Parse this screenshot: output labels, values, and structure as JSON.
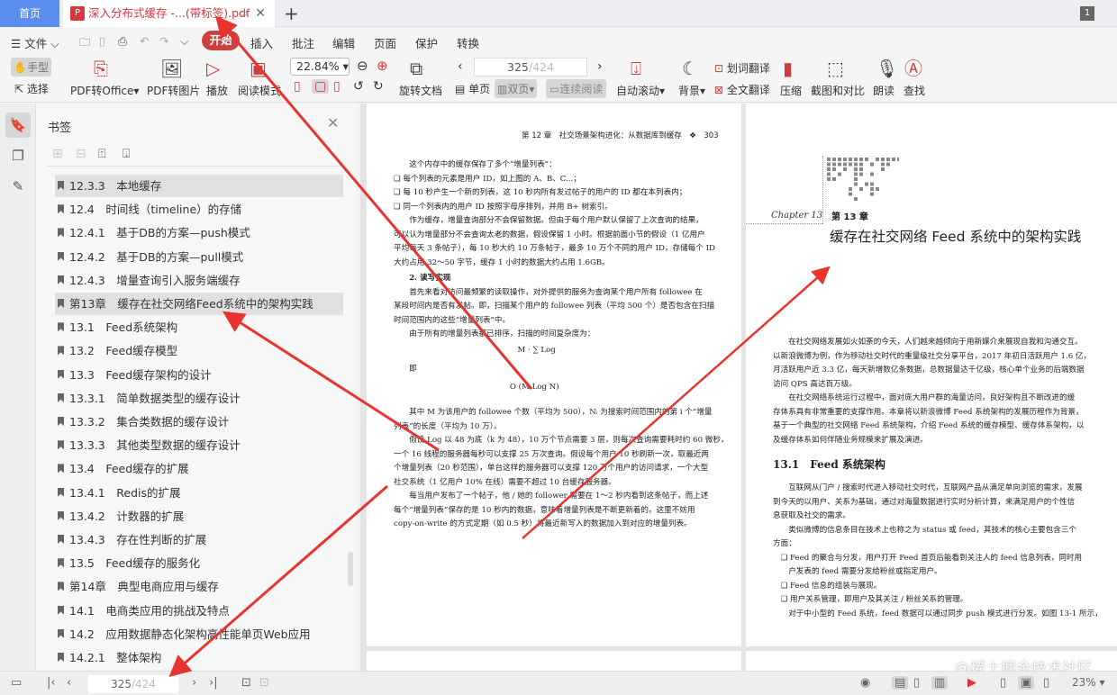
{
  "tabs": {
    "home": "首页",
    "doc": "深入分布式缓存 -...(带标签).pdf",
    "new": "+",
    "count": "1"
  },
  "menu": {
    "file": "文件",
    "items": [
      "开始",
      "插入",
      "批注",
      "编辑",
      "页面",
      "保护",
      "转换"
    ]
  },
  "toolbar": {
    "hand": "手型",
    "select": "选择",
    "pdf_office": "PDF转Office",
    "pdf_image": "PDF转图片",
    "play": "播放",
    "read_mode": "阅读模式",
    "zoom": "22.84%",
    "rotate": "旋转文档",
    "single": "单页",
    "double": "双页",
    "continuous": "连续阅读",
    "auto_scroll": "自动滚动",
    "background": "背景",
    "word_translate": "划词翻译",
    "full_translate": "全文翻译",
    "compress": "压缩",
    "screenshot": "截图和对比",
    "read_aloud": "朗读",
    "find": "查找",
    "page_current": "325",
    "page_total": "/424"
  },
  "panel": {
    "title": "书签",
    "bookmarks": [
      "12.3.3　本地缓存",
      "12.4　时间线（timeline）的存储",
      "12.4.1　基于DB的方案—push模式",
      "12.4.2　基于DB的方案—pull模式",
      "12.4.3　增量查询引入服务端缓存",
      "第13章　缓存在社交网络Feed系统中的架构实践",
      "13.1　Feed系统架构",
      "13.2　Feed缓存模型",
      "13.3　Feed缓存架构的设计",
      "13.3.1　简单数据类型的缓存设计",
      "13.3.2　集合类数据的缓存设计",
      "13.3.3　其他类型数据的缓存设计",
      "13.4　Feed缓存的扩展",
      "13.4.1　Redis的扩展",
      "13.4.2　计数器的扩展",
      "13.4.3　存在性判断的扩展",
      "13.5　Feed缓存的服务化",
      "第14章　典型电商应用与缓存",
      "14.1　电商类应用的挑战及特点",
      "14.2　应用数据静态化架构高性能单页Web应用",
      "14.2.1　整体架构"
    ]
  },
  "left_page": {
    "header": "第 12 章　社交场景架构进化：从数据库到缓存　❖　303",
    "lines": [
      "　　这个内存中的缓存保存了多个“增量列表”：",
      "❑ 每个列表的元素是用户 ID，如上图的 A、B、C...；",
      "❑ 每 10 秒产生一个新的列表，这 10 秒内所有发过帖子的用户的 ID 都在本列表内；",
      "❑ 同一个列表内的用户 ID 按照字母序排列，并用 B+ 树索引。",
      "　　作为缓存，增量查询部分不会保留数据。但由于每个用户默认保留了上次查询的结果，",
      "可以认为增量部分不会查询太老的数据，假设保留 1 小时。根据前面小节的假设（1 亿用户",
      "平均每天 3 条帖子），每 10 秒大约 10 万条帖子，最多 10 万个不同的用户 ID，存储每个 ID",
      "大约占用 32～50 字节，缓存 1 小时的数据大约占用 1.6GB。",
      "　　2. 读写实现",
      "　　首先来看对访问最频繁的读取操作，对外提供的服务为查询某个用户所有 followee 在",
      "某段时间内是否有发帖。即，扫描某个用户的 followee 列表（平均 500 个）是否包含在扫描",
      "时间范围内的这些“增量列表”中。",
      "　　由于所有的增量列表都已排序，扫描的时间复杂度为：",
      "　　　　　　　　　　　　　　　　M · ∑ Log",
      "　　即",
      "　　　　　　　　　　　　　　　O (M Log N)",
      "　　其中 M 为该用户的 followee 个数（平均为 500），Nᵢ 为搜索时间范围内的第 i 个“增量",
      "列表”的长度（平均为 10 万）。",
      "　　假设 Log 以 48 为底（k 为 48），10 万个节点需要 3 层，则每次查询需要耗时约 60 微秒，",
      "一个 16 线程的服务器每秒可以支撑 25 万次查询。假设每个用户 10 秒刷新一次，取最近两",
      "个增量列表（20 秒范围），单台这样的服务器可以支撑 120 万个用户的访问请求，一个大型",
      "社交系统（1 亿用户 10% 在线）需要不超过 10 台缓存服务器。",
      "　　每当用户发布了一个帖子，他 / 她的 follower 需要在 1～2 秒内看到这条帖子，而上述",
      "每个“增量列表”保存的是 10 秒内的数据，意味着增量列表是不断更新着的。这里不妨用",
      "copy-on-write 的方式定期（如 0.5 秒）将最近新写入的数据加入到对应的增量列表。"
    ]
  },
  "right_page": {
    "chapter_en": "Chapter 13",
    "chapter_no": "第 13 章",
    "chapter_title": "缓存在社交网络 Feed 系统中的架构实践",
    "intro": [
      "　　在社交网络发展如火如荼的今天，人们越来越倾向于用新媒介来展现自我和沟通交互。",
      "以新浪微博为例，作为移动社交时代的重量级社交分享平台，2017 年初日活跃用户 1.6 亿，",
      "月活跃用户近 3.3 亿，每天新增数亿条数据，总数据量达千亿级，核心单个业务的后端数据",
      "访问 QPS 高达百万级。",
      "　　在社交网络系统运行过程中，面对庞大用户群的海量访问，良好架构且不断改进的缓",
      "存体系具有非常重要的支撑作用。本章将以新浪微博 Feed 系统架构的发展历程作为背景，",
      "基于一个典型的社交网络 Feed 系统架构，介绍 Feed 系统的缓存模型、缓存体系架构，以",
      "及缓存体系如何伴随业务规模来扩展及演进。"
    ],
    "section": "13.1　Feed 系统架构",
    "body": [
      "　　互联网从门户 / 搜索时代进入移动社交时代，互联网产品从满足单向浏览的需求，发展",
      "到今天的以用户、关系为基础，通过对海量数据进行实时分析计算，来满足用户的个性信",
      "息获取及社交的需求。",
      "　　类似微博的信息条目在技术上也称之为 status 或 feed，其技术的核心主要包含三个",
      "方面：",
      "　❑ Feed 的聚合与分发，用户打开 Feed 首页后能看到关注人的 feed 信息列表，同时用",
      "　　户发表的 feed 需要分发给粉丝或指定用户。",
      "　❑ Feed 信息的组装与展现。",
      "　❑ 用户关系管理，即用户及其关注 / 粉丝关系的管理。",
      "　　对于中小型的 Feed 系统，feed 数据可以通过同步 push 模式进行分发。如图 13-1 所示，"
    ]
  },
  "status": {
    "page_current": "325",
    "page_total": "/424",
    "zoom": "23%"
  },
  "watermark": "@稀土掘金技术社区",
  "colors": {
    "accent": "#c9403e",
    "home_tab": "#5b8def",
    "arrow": "#e8332e"
  }
}
